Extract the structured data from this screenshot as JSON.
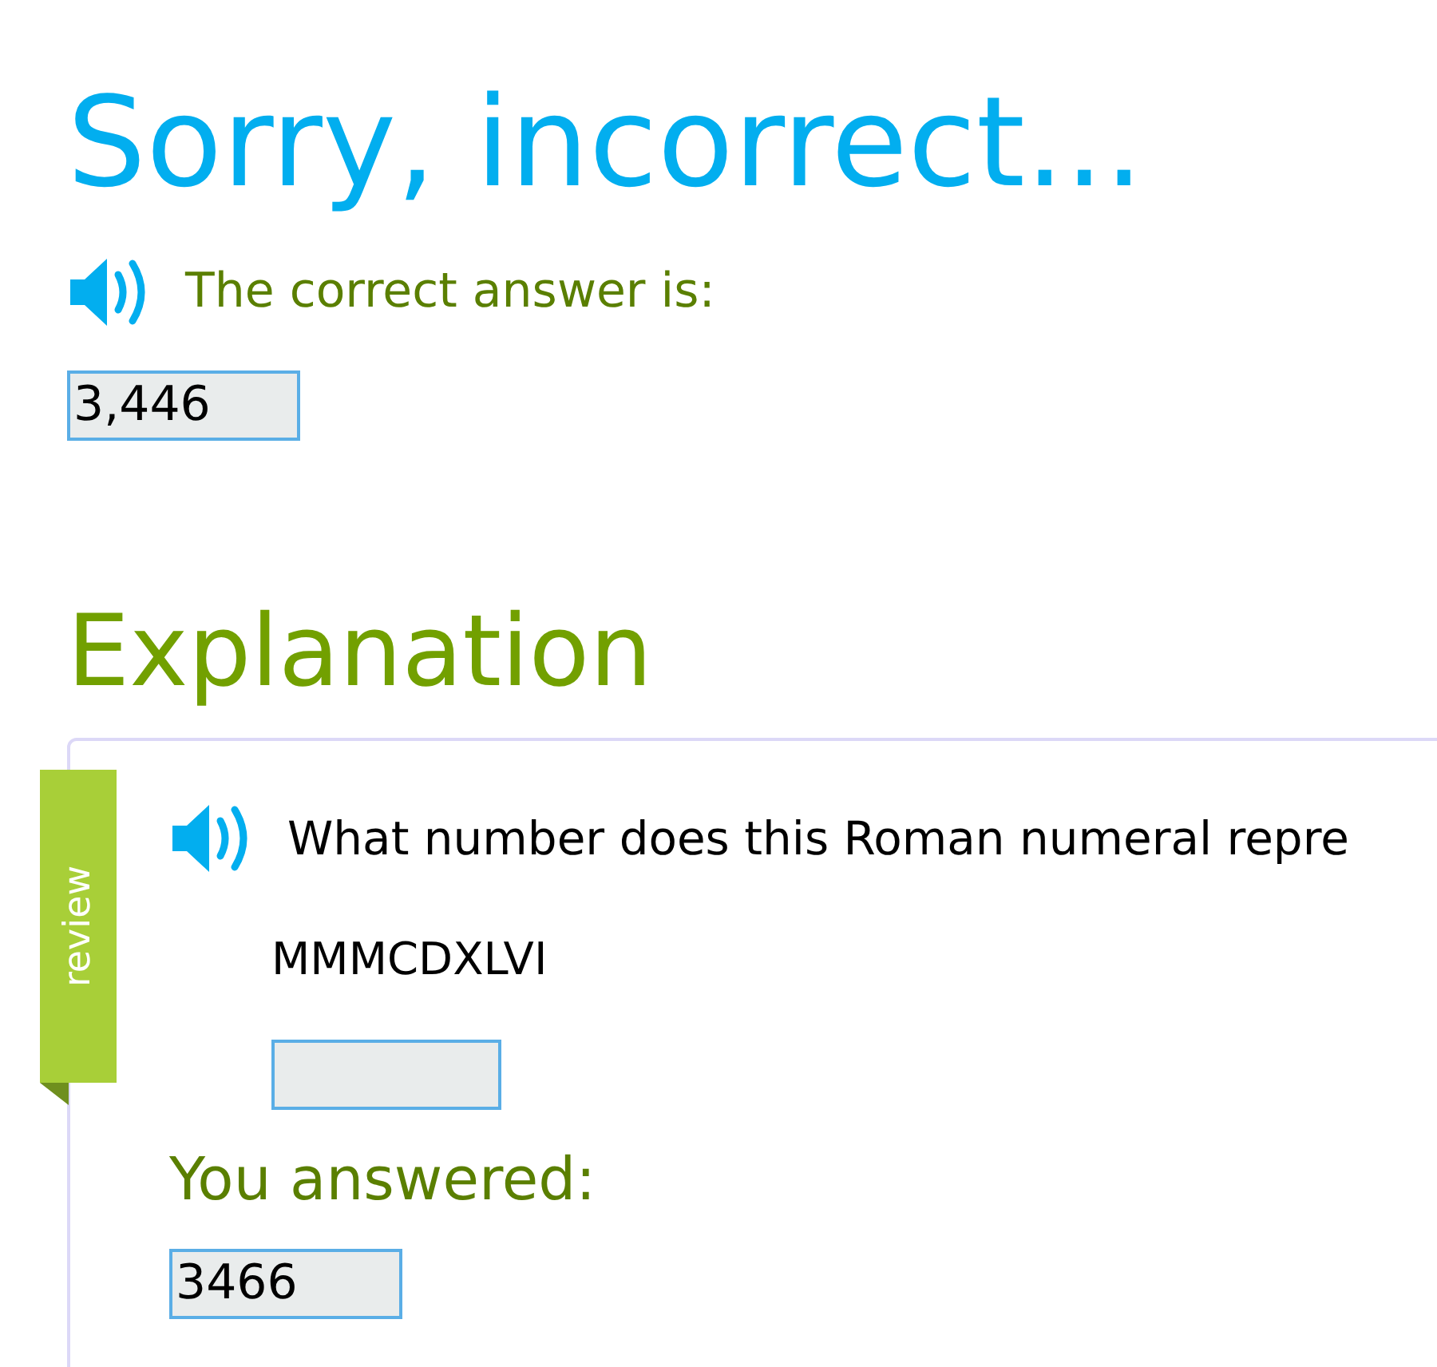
{
  "title": "Sorry, incorrect...",
  "correct_answer": {
    "label": "The correct answer is:",
    "value": "3,446"
  },
  "explanation": {
    "heading": "Explanation",
    "tab": "review",
    "question": "What number does this Roman numeral repre",
    "numeral": "MMMCDXLVI",
    "your_answer": {
      "label": "You answered:",
      "value": "3466"
    }
  }
}
